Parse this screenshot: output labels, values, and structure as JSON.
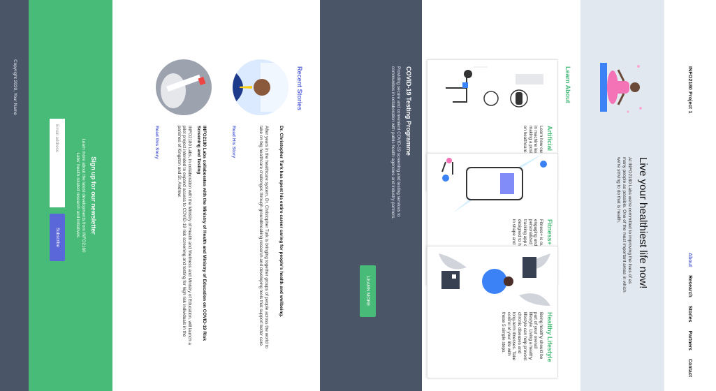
{
  "header": {
    "brand": "INFO2180 Project 1",
    "nav": [
      {
        "label": "About"
      },
      {
        "label": "Research"
      },
      {
        "label": "Stories"
      },
      {
        "label": "Partners"
      },
      {
        "label": "Contact"
      }
    ]
  },
  "hero": {
    "title": "Live your healthiest life now!",
    "text": "At INFO2180 Labs we're committed to improving the lives of as many people as possible. One of the most important areas in which we're striving to do that is health."
  },
  "learn": {
    "heading": "Learn About",
    "cards": [
      {
        "title": "Artificial Intelligence",
        "text": "Learn how our innovations in machine learning are making a positive impact on healthcare.",
        "art": "ai-illustration"
      },
      {
        "title": "Fitness+ Tracker",
        "text": "Fitness+ is our new, engaging and personalized fitness tracking app experience designed to help you stay in shape and feel great.",
        "art": "fitness-illustration"
      },
      {
        "title": "Healthy Lifestyle",
        "text": "Being healthy should be part of your overall lifestyle. Living a healthy lifestyle can help prevent chronic diseases and long-term illnesses. Take control of your life with these 5 simple steps.",
        "art": "lifestyle-illustration"
      }
    ]
  },
  "covid": {
    "heading": "COVID-19 Testing Programme",
    "text": "Providing secure and convenient COVID-19 screening and testing services to communities in collaboration with public health agencies and industry partners.",
    "button": "LEARN MORE"
  },
  "stories": {
    "heading": "Recent Stories",
    "items": [
      {
        "title": "Dr. Christopher Turk has spent his entire career caring for people's health and wellbeing.",
        "text": "After years in the healthcare system, Dr. Christopher Turk is bringing together groups of people across the world to take on big healthcare challenges through groundbreaking research and developing tools that support better care.",
        "link": "Read His Story"
      },
      {
        "title": "INFO2180 Labs collaborates with the Ministry of Health and Ministry of Education on COVID-19 Risk Screening and Testing",
        "text": "INFO2180 Labs, in collaboration with the Ministry of Health and Wellness and Ministry of Education, will launch a pilot project intended to expand access to COVID-19 risk screening and testing for high risk individuals in the parishes of Kingston and St. Andrew.",
        "link": "Read this Story"
      }
    ]
  },
  "newsletter": {
    "heading": "Sign up for our newsletter",
    "text": "Learn more about the latest developments from INFO2180 Labs' health-related research and initiatives.",
    "placeholder": "Email address",
    "button": "Subscribe"
  },
  "footer": {
    "copyright": "Copyright 2020, Your Name"
  },
  "colors": {
    "accent_green": "#48bb78",
    "accent_indigo": "#5a67d8",
    "dark_slate": "#4a5568",
    "hero_bg": "#e2e8f0"
  }
}
